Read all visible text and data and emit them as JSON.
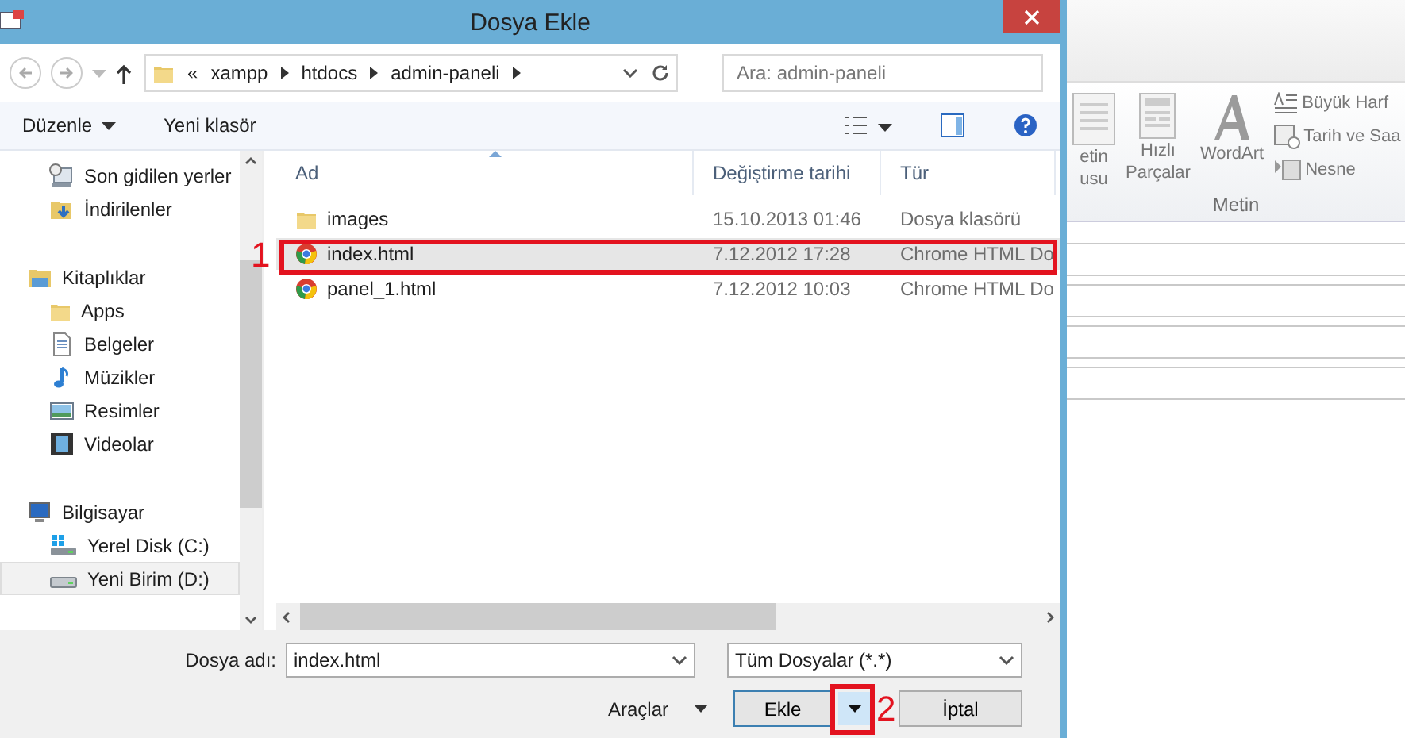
{
  "window": {
    "title": "Dosya Ekle"
  },
  "address": {
    "overflow": "«",
    "crumbs": [
      "xampp",
      "htdocs",
      "admin-paneli"
    ],
    "search_placeholder": "Ara: admin-paneli"
  },
  "toolbar": {
    "organize": "Düzenle",
    "new_folder": "Yeni klasör"
  },
  "nav": [
    {
      "items": [
        {
          "label": "Son gidilen yerler",
          "kind": "recent",
          "selected": false
        },
        {
          "label": "İndirilenler",
          "kind": "downloads",
          "selected": false
        }
      ]
    },
    {
      "label": "Kitaplıklar",
      "kind": "library",
      "items": [
        {
          "label": "Apps",
          "kind": "folder",
          "selected": false
        },
        {
          "label": "Belgeler",
          "kind": "docs",
          "selected": false
        },
        {
          "label": "Müzikler",
          "kind": "music",
          "selected": false
        },
        {
          "label": "Resimler",
          "kind": "pictures",
          "selected": false
        },
        {
          "label": "Videolar",
          "kind": "videos",
          "selected": false
        }
      ]
    },
    {
      "label": "Bilgisayar",
      "kind": "computer",
      "items": [
        {
          "label": "Yerel Disk (C:)",
          "kind": "sysdrive",
          "selected": false
        },
        {
          "label": "Yeni Birim (D:)",
          "kind": "drive",
          "selected": true
        }
      ]
    }
  ],
  "columns": [
    "Ad",
    "Değiştirme tarihi",
    "Tür"
  ],
  "files": [
    {
      "name": "images",
      "date": "15.10.2013 01:46",
      "type": "Dosya klasörü",
      "kind": "folder",
      "selected": false
    },
    {
      "name": "index.html",
      "date": "7.12.2012 17:28",
      "type": "Chrome HTML Do",
      "kind": "chrome",
      "selected": true
    },
    {
      "name": "panel_1.html",
      "date": "7.12.2012 10:03",
      "type": "Chrome HTML Do",
      "kind": "chrome",
      "selected": false
    }
  ],
  "footer": {
    "filename_label": "Dosya adı:",
    "filename": "index.html",
    "filter": "Tüm Dosyalar (*.*)",
    "tools": "Araçlar",
    "open": "Ekle",
    "cancel": "İptal"
  },
  "annotations": [
    "1",
    "2"
  ],
  "word": {
    "ribbon": [
      {
        "label": "etin",
        "label2": "usu",
        "kind": "textbox"
      },
      {
        "label": "Hızlı",
        "label2": "Parçalar",
        "kind": "parts"
      },
      {
        "label": "WordArt",
        "kind": "wordart"
      }
    ],
    "small": [
      {
        "label": "Büyük Harf",
        "kind": "dropcap"
      },
      {
        "label": "Tarih ve Saa",
        "kind": "date"
      },
      {
        "label": "Nesne",
        "kind": "object"
      }
    ],
    "group": "Metin"
  }
}
